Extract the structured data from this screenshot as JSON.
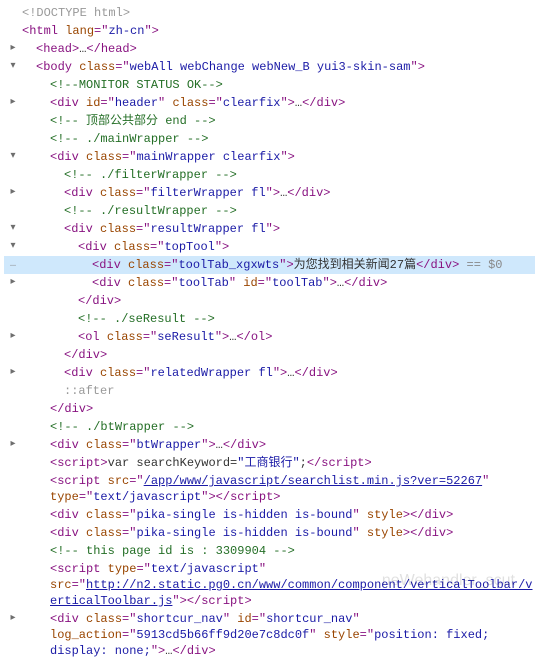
{
  "doctype": "<!DOCTYPE html>",
  "html_open": {
    "tag": "html",
    "attrs": [
      {
        "name": "lang",
        "value": "zh-cn"
      }
    ]
  },
  "head": {
    "tag": "head"
  },
  "body_open": {
    "tag": "body",
    "attrs": [
      {
        "name": "class",
        "value": "webAll webChange webNew_B yui3-skin-sam"
      }
    ]
  },
  "comment_monitor": "MONITOR STATUS OK",
  "div_header": {
    "tag": "div",
    "attrs": [
      {
        "name": "id",
        "value": "header"
      },
      {
        "name": "class",
        "value": "clearfix"
      }
    ]
  },
  "comment_top_end": " 顶部公共部分 end ",
  "comment_mainwrapper": " ./mainWrapper ",
  "div_mainwrapper": {
    "tag": "div",
    "attrs": [
      {
        "name": "class",
        "value": "mainWrapper clearfix"
      }
    ]
  },
  "comment_filterwrapper": " ./filterWrapper ",
  "div_filterwrapper": {
    "tag": "div",
    "attrs": [
      {
        "name": "class",
        "value": "filterWrapper fl"
      }
    ]
  },
  "comment_resultwrapper": " ./resultWrapper ",
  "div_resultwrapper": {
    "tag": "div",
    "attrs": [
      {
        "name": "class",
        "value": "resultWrapper fl"
      }
    ]
  },
  "div_toptool": {
    "tag": "div",
    "attrs": [
      {
        "name": "class",
        "value": "topTool"
      }
    ]
  },
  "div_tooltab_xgxwts": {
    "tag": "div",
    "attrs": [
      {
        "name": "class",
        "value": "toolTab_xgxwts"
      }
    ],
    "text": "为您找到相关新闻27篇"
  },
  "eq_zero": " == $0",
  "div_tooltab": {
    "tag": "div",
    "attrs": [
      {
        "name": "class",
        "value": "toolTab"
      },
      {
        "name": "id",
        "value": "toolTab"
      }
    ]
  },
  "close_div": "</div>",
  "comment_seresult": " ./seResult ",
  "ol_seresult": {
    "tag": "ol",
    "attrs": [
      {
        "name": "class",
        "value": "seResult"
      }
    ]
  },
  "div_relatedwrapper": {
    "tag": "div",
    "attrs": [
      {
        "name": "class",
        "value": "relatedWrapper fl"
      }
    ]
  },
  "pseudo_after": "::after",
  "comment_btwrapper": " ./btWrapper ",
  "div_btwrapper": {
    "tag": "div",
    "attrs": [
      {
        "name": "class",
        "value": "btWrapper"
      }
    ]
  },
  "script_keyword": {
    "tag": "script",
    "js_pre": "var searchKeyword=",
    "js_str": "\"工商银行\"",
    "js_post": ";"
  },
  "script_searchlist": {
    "tag": "script",
    "attrs": [
      {
        "name": "src",
        "value": "/app/www/javascript/searchlist.min.js?ver=52267",
        "link": true
      },
      {
        "name": "type",
        "value": "text/javascript"
      }
    ]
  },
  "div_pika1": {
    "tag": "div",
    "attrs": [
      {
        "name": "class",
        "value": "pika-single is-hidden is-bound"
      },
      {
        "name": "style",
        "value": "",
        "novalue": true
      }
    ]
  },
  "div_pika2": {
    "tag": "div",
    "attrs": [
      {
        "name": "class",
        "value": "pika-single is-hidden is-bound"
      },
      {
        "name": "style",
        "value": "",
        "novalue": true
      }
    ]
  },
  "comment_pageid": " this page id is : 3309904 ",
  "script_toolbar": {
    "tag": "script",
    "attrs": [
      {
        "name": "type",
        "value": "text/javascript"
      },
      {
        "name": "src",
        "value": "http://n2.static.pg0.cn/www/common/component/verticalToolbar/verticalToolbar.js",
        "link": true
      }
    ]
  },
  "div_shortcut": {
    "tag": "div",
    "attrs": [
      {
        "name": "class",
        "value": "shortcur_nav"
      },
      {
        "name": "id",
        "value": "shortcur_nav"
      },
      {
        "name": "log_action",
        "value": "5913cd5b66ff9d20e7c8dc0f"
      },
      {
        "name": "style",
        "value": "position: fixed; display: none;"
      }
    ]
  },
  "ellipsis_marker": "…",
  "selected_gutter": "…",
  "watermark": "neWehandler_scut"
}
